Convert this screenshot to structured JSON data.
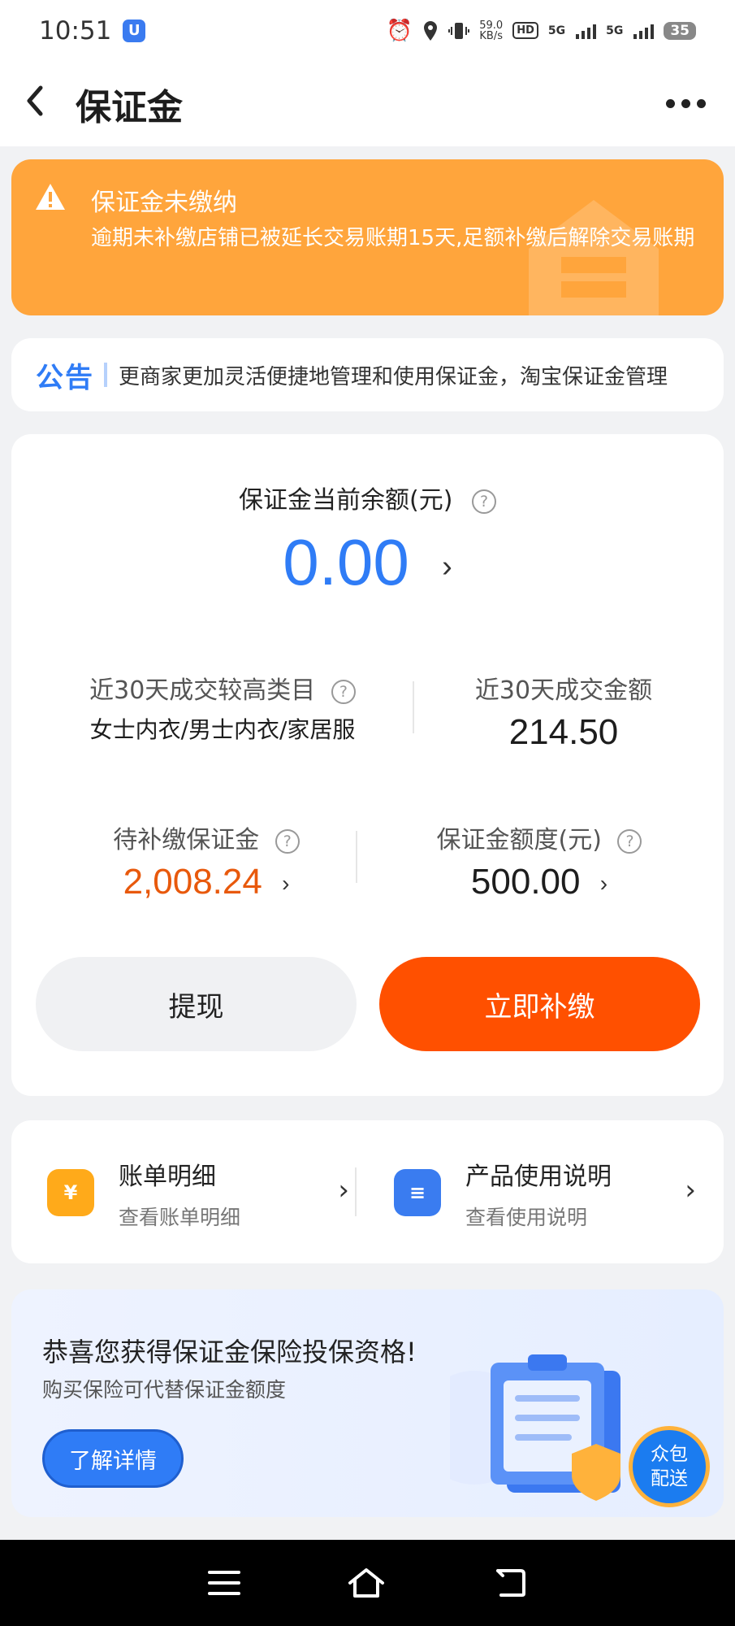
{
  "status_bar": {
    "time": "10:51",
    "app_badge": "U",
    "net_speed_value": "59.0",
    "net_speed_unit": "KB/s",
    "hd_label": "HD",
    "sim1": "5G",
    "sim2": "5G",
    "battery": "35"
  },
  "nav": {
    "back_icon": "‹",
    "title": "保证金"
  },
  "alert": {
    "title": "保证金未缴纳",
    "description": "逾期未补缴店铺已被延长交易账期15天,足额补缴后解除交易账期",
    "color": "#ffa53c"
  },
  "notice": {
    "label": "公告",
    "text": "更商家更加灵活便捷地管理和使用保证金，淘宝保证金管理"
  },
  "balance": {
    "label": "保证金当前余额(元)",
    "value": "0.00",
    "help": "?",
    "chevron": "›"
  },
  "stats": {
    "top_category_label": "近30天成交较高类目",
    "top_category_value": "女士内衣/男士内衣/家居服",
    "deal_amount_label": "近30天成交金额",
    "deal_amount_value": "214.50",
    "pending_label": "待补缴保证金",
    "pending_value": "2,008.24",
    "quota_label": "保证金额度(元)",
    "quota_value": "500.00"
  },
  "actions": {
    "withdraw_label": "提现",
    "pay_now_label": "立即补缴",
    "accent_color": "#ff5000"
  },
  "links": [
    {
      "title": "账单明细",
      "subtitle": "查看账单明细",
      "icon": "¥"
    },
    {
      "title": "产品使用说明",
      "subtitle": "查看使用说明",
      "icon": "≡"
    }
  ],
  "promo": {
    "title": "恭喜您获得保证金保险投保资格!",
    "subtitle": "购买保险可代替保证金额度",
    "button": "了解详情",
    "float_button_line1": "众包",
    "float_button_line2": "配送"
  }
}
